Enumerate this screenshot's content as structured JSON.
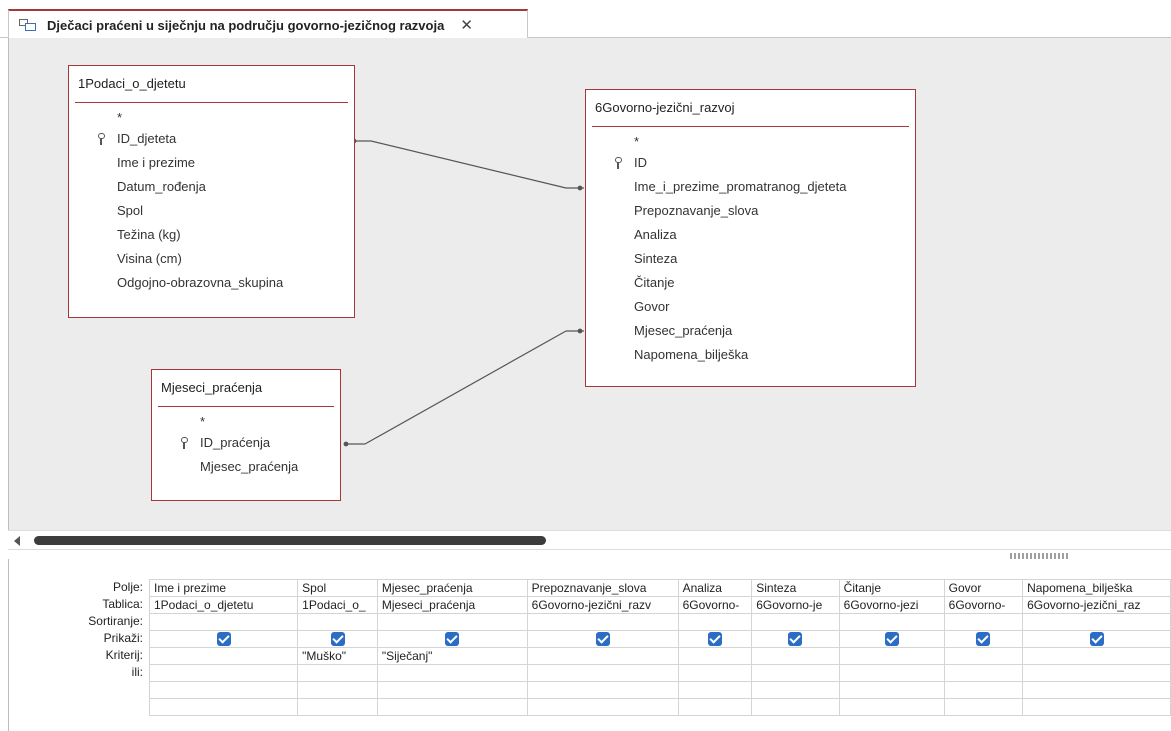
{
  "tab": {
    "title": "Dječaci praćeni u siječnju na području govorno-jezičnog razvoja",
    "close": "✕"
  },
  "tables": [
    {
      "name": "1Podaci_o_djetetu",
      "star": "*",
      "key_field": "ID_djeteta",
      "fields": [
        "Ime i prezime",
        "Datum_rođenja",
        "Spol",
        "Težina (kg)",
        "Visina (cm)",
        "Odgojno-obrazovna_skupina"
      ]
    },
    {
      "name": "6Govorno-jezični_razvoj",
      "star": "*",
      "key_field": "ID",
      "fields": [
        "Ime_i_prezime_promatranog_djeteta",
        "Prepoznavanje_slova",
        "Analiza",
        "Sinteza",
        "Čitanje",
        "Govor",
        "Mjesec_praćenja",
        "Napomena_bilješka"
      ]
    },
    {
      "name": "Mjeseci_praćenja",
      "star": "*",
      "key_field": "ID_praćenja",
      "fields": [
        "Mjesec_praćenja"
      ]
    }
  ],
  "grid": {
    "row_labels": [
      "Polje:",
      "Tablica:",
      "Sortiranje:",
      "Prikaži:",
      "Kriterij:",
      "ili:"
    ],
    "columns": [
      {
        "field": "Ime i prezime",
        "table": "1Podaci_o_djetetu",
        "criteria": ""
      },
      {
        "field": "Spol",
        "table": "1Podaci_o_",
        "criteria": "\"Muško\""
      },
      {
        "field": "Mjesec_praćenja",
        "table": "Mjeseci_praćenja",
        "criteria": "\"Siječanj\""
      },
      {
        "field": "Prepoznavanje_slova",
        "table": "6Govorno-jezični_razv",
        "criteria": ""
      },
      {
        "field": "Analiza",
        "table": "6Govorno-",
        "criteria": ""
      },
      {
        "field": "Sinteza",
        "table": "6Govorno-je",
        "criteria": ""
      },
      {
        "field": "Čitanje",
        "table": "6Govorno-jezi",
        "criteria": ""
      },
      {
        "field": "Govor",
        "table": "6Govorno-",
        "criteria": ""
      },
      {
        "field": "Napomena_bilješka",
        "table": "6Govorno-jezični_raz",
        "criteria": ""
      }
    ]
  },
  "colors": {
    "accent": "#a4373a",
    "checkbox": "#2b6cc4",
    "design_bg": "#ececec"
  }
}
